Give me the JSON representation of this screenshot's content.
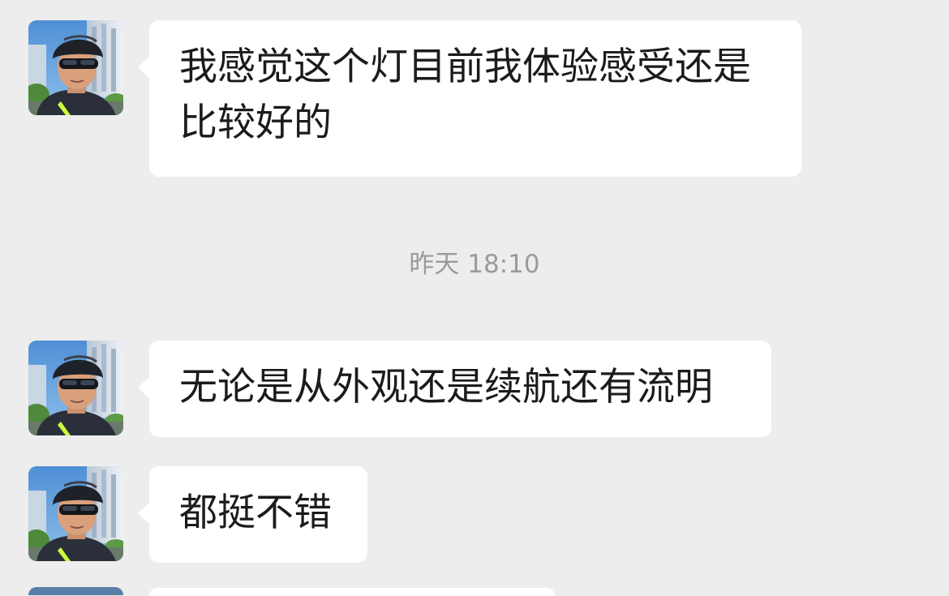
{
  "conversation": {
    "messages": [
      {
        "sender": "contact",
        "lines": [
          "我感觉这个灯目前我体验感受还是",
          "比较好的"
        ]
      },
      {
        "sender": "contact",
        "lines": [
          "无论是从外观还是续航还有流明"
        ]
      },
      {
        "sender": "contact",
        "lines": [
          "都挺不错"
        ]
      }
    ],
    "timestamp": "昨天 18:10"
  },
  "colors": {
    "background": "#ededed",
    "bubble": "#ffffff",
    "text": "#1b1b1b",
    "timestamp": "#9a9a9a"
  },
  "icons": {
    "avatar": "contact-avatar-cyclist"
  }
}
